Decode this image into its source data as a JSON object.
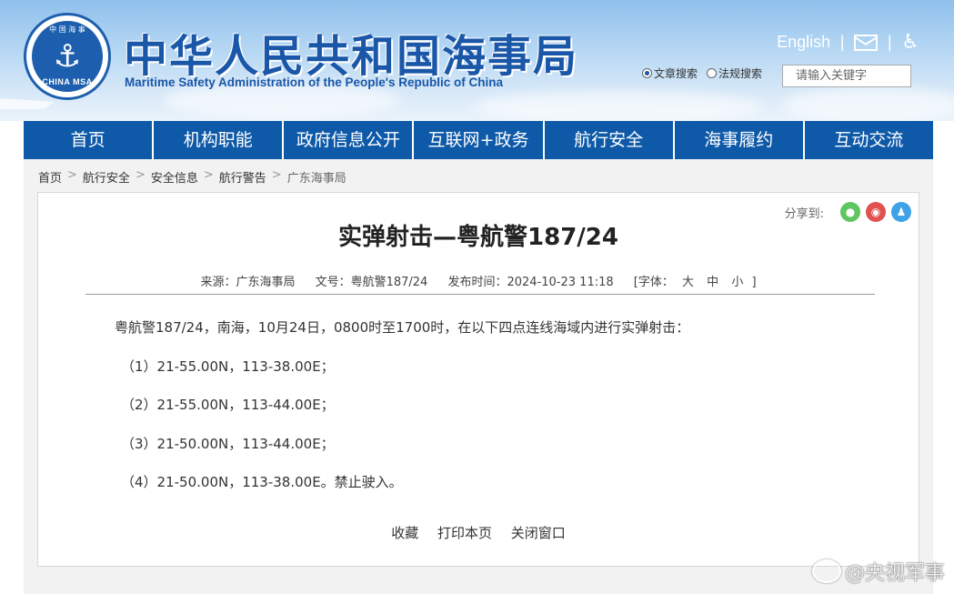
{
  "header": {
    "emblem_top": "中 国 海 事",
    "emblem_text": "CHINA MSA",
    "title": "中华人民共和国海事局",
    "subtitle": "Maritime Safety Administration of the People's Republic of China",
    "english_link": "English",
    "separator": "|",
    "icons": [
      "mail-icon",
      "accessibility-icon"
    ],
    "search": {
      "option_article": "文章搜索",
      "option_regulation": "法规搜索",
      "selected": "文章搜索",
      "placeholder": "请输入关键字"
    }
  },
  "nav": {
    "items": [
      "首页",
      "机构职能",
      "政府信息公开",
      "互联网+政务",
      "航行安全",
      "海事履约",
      "互动交流"
    ]
  },
  "breadcrumb": {
    "items": [
      "首页",
      "航行安全",
      "安全信息",
      "航行警告",
      "广东海事局"
    ],
    "separator": ">"
  },
  "article": {
    "share_label": "分享到:",
    "title": "实弹射击—粤航警187/24",
    "meta": {
      "source": "来源：广东海事局",
      "doc_no": "文号：粤航警187/24",
      "publish_time": "发布时间：2024-10-23 11:18",
      "font_label_open": "[字体：",
      "font_large": "大",
      "font_medium": "中",
      "font_small": "小",
      "font_label_close": "]"
    },
    "paragraphs": [
      "粤航警187/24，南海，10月24日，0800时至1700时，在以下四点连线海域内进行实弹射击：",
      "（1）21-55.00N，113-38.00E；",
      "（2）21-55.00N，113-44.00E；",
      "（3）21-50.00N，113-44.00E；",
      "（4）21-50.00N，113-38.00E。禁止驶入。"
    ],
    "actions": {
      "favorite": "收藏",
      "print": "打印本页",
      "close": "关闭窗口"
    }
  },
  "watermark": "@央视军事",
  "colors": {
    "nav_bg": "#0f5aa8",
    "title_blue": "#1a57a8",
    "wechat": "#5fc55f",
    "weibo": "#e0514f",
    "qq": "#3fa2e8"
  }
}
